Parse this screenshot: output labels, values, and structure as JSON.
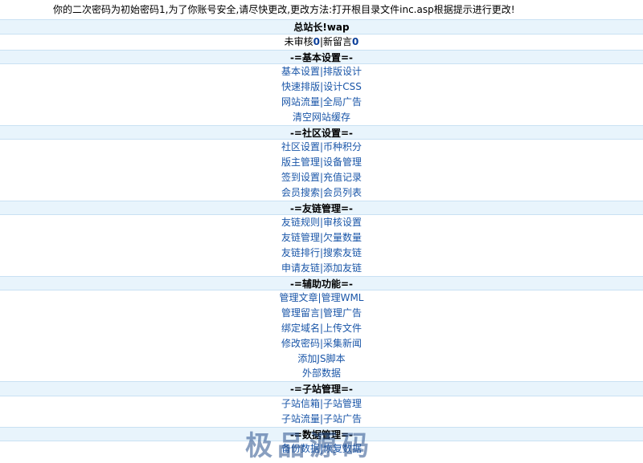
{
  "notice": "你的二次密码为初始密码1,为了你账号安全,请尽快更改,更改方法:打开根目录文件inc.asp根据提示进行更改!",
  "title": "总站长!wap",
  "pending": {
    "label1": "未审核",
    "count1": "0",
    "sep": "|",
    "label2": "新留言",
    "count2": "0"
  },
  "sections": [
    {
      "heading": "-=基本设置=-",
      "rows": [
        [
          "基本设置",
          "排版设计"
        ],
        [
          "快速排版",
          "设计CSS"
        ],
        [
          "网站流量",
          "全局广告"
        ],
        [
          "清空网站缓存"
        ]
      ]
    },
    {
      "heading": "-=社区设置=-",
      "rows": [
        [
          "社区设置",
          "币种积分"
        ],
        [
          "版主管理",
          "设备管理"
        ],
        [
          "签到设置",
          "充值记录"
        ],
        [
          "会员搜索",
          "会员列表"
        ]
      ]
    },
    {
      "heading": "-=友链管理=-",
      "rows": [
        [
          "友链规则",
          "审核设置"
        ],
        [
          "友链管理",
          "欠量数量"
        ],
        [
          "友链排行",
          "搜索友链"
        ],
        [
          "申请友链",
          "添加友链"
        ]
      ]
    },
    {
      "heading": "-=辅助功能=-",
      "rows": [
        [
          "管理文章",
          "管理WML"
        ],
        [
          "管理留言",
          "管理广告"
        ],
        [
          "绑定域名",
          "上传文件"
        ],
        [
          "修改密码",
          "采集新闻"
        ],
        [
          "添加JS脚本"
        ],
        [
          "外部数据"
        ]
      ]
    },
    {
      "heading": "-=子站管理=-",
      "rows": [
        [
          "子站信箱",
          "子站管理"
        ],
        [
          "子站流量",
          "子站广告"
        ]
      ]
    },
    {
      "heading": "-=数据管理=-",
      "rows": [
        [
          "备份数据",
          "恢复数据"
        ]
      ]
    }
  ],
  "watermark": "极品源码",
  "colors": {
    "link": "#1a56a8",
    "header_bg": "#e8f4fc",
    "count": "#0b3f9a"
  }
}
